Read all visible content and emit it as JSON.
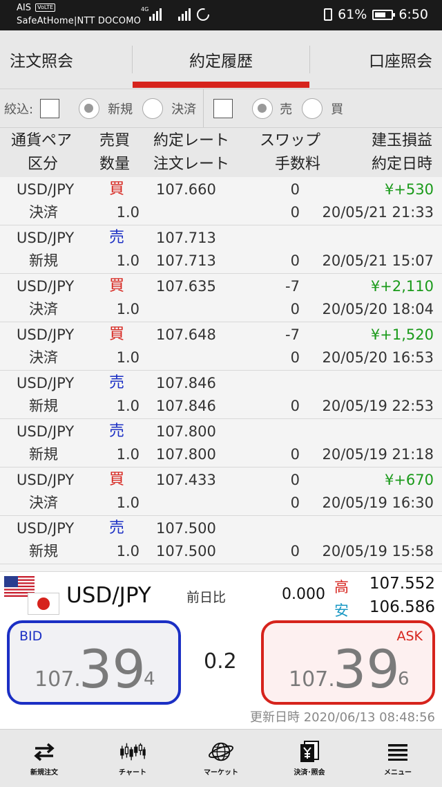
{
  "statusbar": {
    "carrier": "AIS",
    "volte": "VoLTE",
    "network": "SafeAtHome|NTT DOCOMO",
    "net_type": "4G",
    "battery": "61%",
    "time": "6:50"
  },
  "tabs": [
    {
      "label": "注文照会"
    },
    {
      "label": "約定履歴"
    },
    {
      "label": "口座照会"
    }
  ],
  "filter": {
    "label": "絞込:",
    "new": "新規",
    "settle": "決済",
    "sell": "売",
    "buy": "買"
  },
  "table_header": {
    "pair": "通貨ペア",
    "kind": "区分",
    "side": "売買",
    "qty": "数量",
    "rate": "約定レート",
    "order_rate": "注文レート",
    "swap": "スワップ",
    "fee": "手数料",
    "pl": "建玉損益",
    "date": "約定日時"
  },
  "rows": [
    {
      "pair": "USD/JPY",
      "side": "買",
      "rate": "107.660",
      "swap": "0",
      "pl": "¥+530",
      "kind": "決済",
      "qty": "1.0",
      "order_rate": "",
      "fee": "0",
      "date": "20/05/21 21:33"
    },
    {
      "pair": "USD/JPY",
      "side": "売",
      "rate": "107.713",
      "swap": "",
      "pl": "",
      "kind": "新規",
      "qty": "1.0",
      "order_rate": "107.713",
      "fee": "0",
      "date": "20/05/21 15:07"
    },
    {
      "pair": "USD/JPY",
      "side": "買",
      "rate": "107.635",
      "swap": "-7",
      "pl": "¥+2,110",
      "kind": "決済",
      "qty": "1.0",
      "order_rate": "",
      "fee": "0",
      "date": "20/05/20 18:04"
    },
    {
      "pair": "USD/JPY",
      "side": "買",
      "rate": "107.648",
      "swap": "-7",
      "pl": "¥+1,520",
      "kind": "決済",
      "qty": "1.0",
      "order_rate": "",
      "fee": "0",
      "date": "20/05/20 16:53"
    },
    {
      "pair": "USD/JPY",
      "side": "売",
      "rate": "107.846",
      "swap": "",
      "pl": "",
      "kind": "新規",
      "qty": "1.0",
      "order_rate": "107.846",
      "fee": "0",
      "date": "20/05/19 22:53"
    },
    {
      "pair": "USD/JPY",
      "side": "売",
      "rate": "107.800",
      "swap": "",
      "pl": "",
      "kind": "新規",
      "qty": "1.0",
      "order_rate": "107.800",
      "fee": "0",
      "date": "20/05/19 21:18"
    },
    {
      "pair": "USD/JPY",
      "side": "買",
      "rate": "107.433",
      "swap": "0",
      "pl": "¥+670",
      "kind": "決済",
      "qty": "1.0",
      "order_rate": "",
      "fee": "0",
      "date": "20/05/19 16:30"
    },
    {
      "pair": "USD/JPY",
      "side": "売",
      "rate": "107.500",
      "swap": "",
      "pl": "",
      "kind": "新規",
      "qty": "1.0",
      "order_rate": "107.500",
      "fee": "0",
      "date": "20/05/19 15:58"
    }
  ],
  "quote": {
    "pair": "USD/JPY",
    "prev_label": "前日比",
    "prev_change": "0.000",
    "high_label": "高",
    "low_label": "安",
    "high": "107.552",
    "low": "106.586",
    "bid_label": "BID",
    "ask_label": "ASK",
    "bid_prefix": "107.",
    "bid_big": "39",
    "bid_sub": "4",
    "ask_prefix": "107.",
    "ask_big": "39",
    "ask_sub": "6",
    "spread": "0.2",
    "updated": "更新日時  2020/06/13 08:48:56"
  },
  "nav": [
    {
      "label": "新規注文",
      "icon": "swap-arrows-icon"
    },
    {
      "label": "チャート",
      "icon": "candlestick-chart-icon"
    },
    {
      "label": "マーケット",
      "icon": "globe-icon"
    },
    {
      "label": "決済･照会",
      "icon": "document-yen-icon"
    },
    {
      "label": "メニュー",
      "icon": "hamburger-menu-icon"
    }
  ],
  "colors": {
    "accent_red": "#d6231c",
    "sell_blue": "#1b2fc4",
    "profit_green": "#1a9a1a",
    "low_cyan": "#1a98c4"
  }
}
